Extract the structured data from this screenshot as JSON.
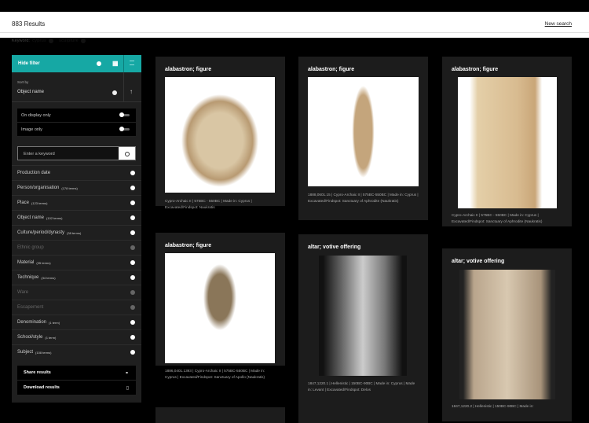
{
  "header": {
    "results": "883 Results",
    "new_search": "New search",
    "keyword_label": "Keyword:",
    "keywords": [
      "cyprus",
      "sculpture"
    ]
  },
  "sidebar": {
    "hide_filter": "Hide filter",
    "sort_label": "Sort by",
    "sort_value": "Object name",
    "toggles": [
      "On display only",
      "Image only"
    ],
    "search_placeholder": "Enter a keyword",
    "facets": [
      {
        "label": "Production date",
        "count": "",
        "enabled": true
      },
      {
        "label": "Person/organisation",
        "count": "(178 terms)",
        "enabled": true
      },
      {
        "label": "Place",
        "count": "(123 terms)",
        "enabled": true
      },
      {
        "label": "Object name",
        "count": "(102 terms)",
        "enabled": true
      },
      {
        "label": "Culture/period/dynasty",
        "count": "(38 terms)",
        "enabled": true
      },
      {
        "label": "Ethnic group",
        "count": "",
        "enabled": false
      },
      {
        "label": "Material",
        "count": "(35 terms)",
        "enabled": true
      },
      {
        "label": "Technique",
        "count": "(34 terms)",
        "enabled": true
      },
      {
        "label": "Ware",
        "count": "",
        "enabled": false
      },
      {
        "label": "Escapement",
        "count": "",
        "enabled": false
      },
      {
        "label": "Denomination",
        "count": "(1 term)",
        "enabled": true
      },
      {
        "label": "School/style",
        "count": "(1 term)",
        "enabled": true
      },
      {
        "label": "Subject",
        "count": "(108 terms)",
        "enabled": true
      }
    ],
    "share": "Share results",
    "download": "Download results"
  },
  "cards": [
    {
      "title": "alabastron; figure",
      "desc": "Cypro-Archaic II | 575BC - 550BC | Made in: Cyprus | Excavated/Findspot: Naukratis"
    },
    {
      "title": "alabastron; figure",
      "desc": "1888,0601.15 | Cypro-Archaic II | 575BC-550BC | Made in: Cyprus | Excavated/Findspot: Sanctuary of Aphrodite (Naukratis)"
    },
    {
      "title": "alabastron; figure",
      "desc": "Cypro-Archaic II | 575BC - 550BC | Made in: Cyprus | Excavated/Findspot: Sanctuary of Aphrodite (Naukratis)"
    },
    {
      "title": "alabastron; figure",
      "desc": "1886,0401.1393 | Cypro-Archaic II | 575BC-550BC | Made in: Cyprus | Excavated/Findspot: Sanctuary of Apollo (Naukratis)"
    },
    {
      "title": "altar; votive offering",
      "desc": "1847,1220.1 | Hellenistic | 150BC-90BC | Made in: Cyprus | Made in: Levant | Excavated/Findspot: Delos"
    },
    {
      "title": "altar; votive offering",
      "desc": "1847,1220.2 | Hellenistic | 150BC-90BC | Made in:"
    }
  ]
}
